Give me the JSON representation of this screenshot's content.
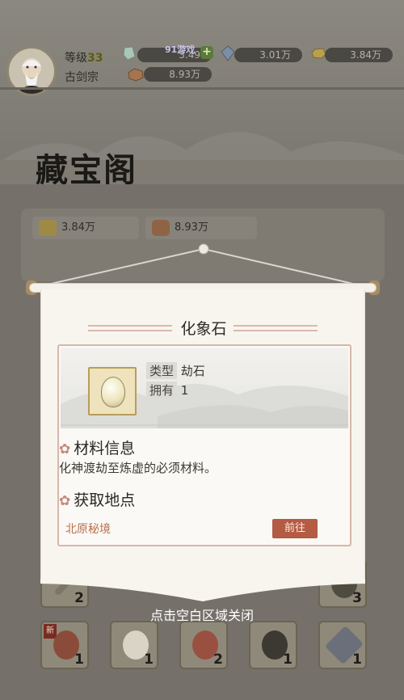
{
  "header": {
    "level_label": "等级",
    "level_value": "33",
    "sect": "古剑宗",
    "resources": [
      {
        "name": "jade",
        "value": "3.49"
      },
      {
        "name": "crystal",
        "value": "3.01万"
      },
      {
        "name": "gold-ingot",
        "value": "3.84万"
      },
      {
        "name": "copper-ore",
        "value": "8.93万"
      }
    ],
    "watermark": "91游戏"
  },
  "page_title": "藏宝阁",
  "strip": {
    "items": [
      {
        "value": "3.84万"
      },
      {
        "value": "8.93万"
      }
    ]
  },
  "popup": {
    "item_name": "化象石",
    "type_label": "类型",
    "type_value": "劫石",
    "own_label": "拥有",
    "own_value": "1",
    "info_title": "材料信息",
    "info_desc": "化神渡劫至炼虚的必须材料。",
    "source_title": "获取地点",
    "source_location": "北原秘境",
    "goto_label": "前往"
  },
  "grid": {
    "row1_counts": [
      "2",
      "",
      "",
      "",
      "",
      "3"
    ],
    "row2_counts": [
      "1",
      "1",
      "2",
      "1",
      "1"
    ],
    "new_tag": "新"
  },
  "close_hint": "点击空白区域关闭",
  "colors": {
    "accent": "#b45b43",
    "title": "#1a1916",
    "scroll": "#f8f5ef"
  }
}
